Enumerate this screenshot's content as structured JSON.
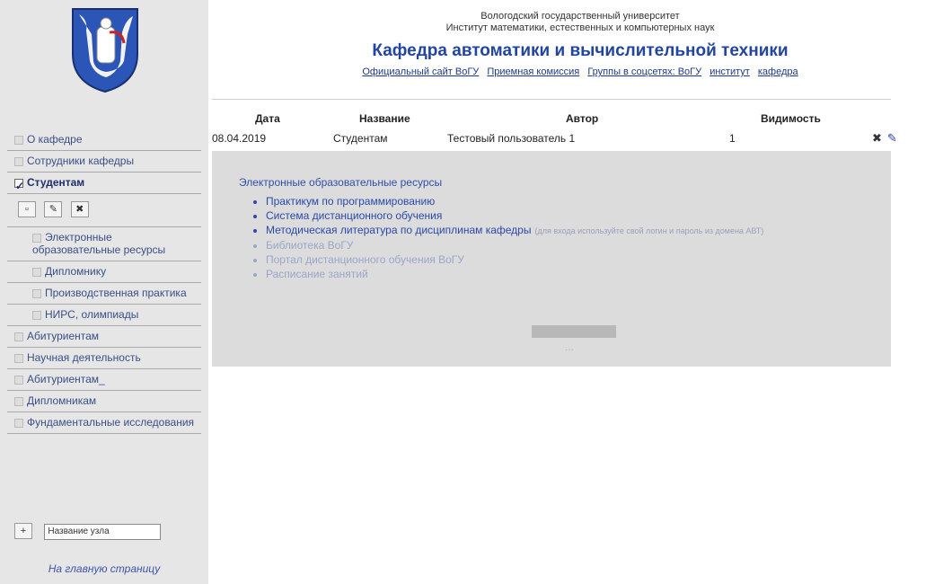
{
  "header": {
    "university": "Вологодский государственный университет",
    "institute": "Институт математики, естественных и компьютерных наук",
    "title": "Кафедра автоматики и вычислительной техники",
    "links": [
      "Официальный сайт ВоГУ",
      "Приемная комиссия",
      "Группы в соцсетях: ВоГУ",
      "институт",
      "кафедра"
    ]
  },
  "sidebar": {
    "items": [
      "О кафедре",
      "Сотрудники кафедры",
      "Студентам",
      "Электронные образовательные ресурсы",
      "Дипломнику",
      "Производственная практика",
      "НИРС, олимпиады",
      "Абитуриентам",
      "Научная деятельность",
      "Абитуриентам_",
      "Дипломникам",
      "Фундаментальные исследования"
    ],
    "node_input_value": "Название узла",
    "home_link": "На главную страницу",
    "add_button": "+"
  },
  "table": {
    "headers": [
      "Дата",
      "Название",
      "Автор",
      "Видимость"
    ],
    "row": {
      "date": "08.04.2019",
      "name": "Студентам",
      "author": "Тестовый пользователь 1",
      "visibility": "1"
    }
  },
  "content": {
    "title": "Электронные образовательные ресурсы",
    "items": [
      "Практикум по программированию",
      "Система дистанционного обучения",
      "Методическая литература по дисциплинам кафедры",
      "Библиотека ВоГУ",
      "Портал дистанционного обучения ВоГУ",
      "Расписание занятий"
    ],
    "note": "(для входа используйте свой логин и пароль из домена АВТ)"
  },
  "colors": {
    "sidebar_bg": "#e6e6e6",
    "title": "#2245a0",
    "panel_bg": "#dcdcdc"
  }
}
